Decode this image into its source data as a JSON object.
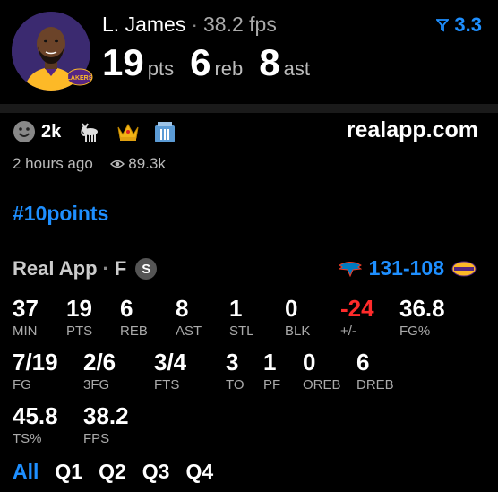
{
  "header": {
    "player_name": "L. James",
    "separator": "·",
    "fps_label": "38.2 fps",
    "rating": "3.3",
    "rating_icon": "filter-funnel-icon",
    "points": "19",
    "points_unit": "pts",
    "rebounds": "6",
    "rebounds_unit": "reb",
    "assists": "8",
    "assists_unit": "ast",
    "team_logo_text": "LAKERS"
  },
  "reactions": {
    "count": "2k",
    "icons": [
      "smiley-icon",
      "goat-icon",
      "crown-icon",
      "trash-icon"
    ]
  },
  "site": "realapp.com",
  "meta": {
    "time_ago": "2 hours ago",
    "views": "89.3k"
  },
  "hashtag": "#10points",
  "source": {
    "name": "Real App",
    "dot": "·",
    "position": "F",
    "badge": "S"
  },
  "score": {
    "home": "131",
    "dash": "-",
    "away": "108"
  },
  "stats_row1": [
    {
      "value": "37",
      "label": "MIN"
    },
    {
      "value": "19",
      "label": "PTS"
    },
    {
      "value": "6",
      "label": "REB"
    },
    {
      "value": "8",
      "label": "AST"
    },
    {
      "value": "1",
      "label": "STL"
    },
    {
      "value": "0",
      "label": "BLK"
    },
    {
      "value": "-24",
      "label": "+/-"
    },
    {
      "value": "36.8",
      "label": "FG%"
    }
  ],
  "stats_row2": [
    {
      "value": "7/19",
      "label": "FG"
    },
    {
      "value": "2/6",
      "label": "3FG"
    },
    {
      "value": "3/4",
      "label": "FTS"
    },
    {
      "value": "3",
      "label": "TO"
    },
    {
      "value": "1",
      "label": "PF"
    },
    {
      "value": "0",
      "label": "OREB"
    },
    {
      "value": "6",
      "label": "DREB"
    }
  ],
  "stats_row3": [
    {
      "value": "45.8",
      "label": "TS%"
    },
    {
      "value": "38.2",
      "label": "FPS"
    }
  ],
  "tabs": [
    "All",
    "Q1",
    "Q2",
    "Q3",
    "Q4"
  ],
  "colors": {
    "accent": "#1e8fff",
    "negative": "#ff2b2b",
    "lakers_gold": "#fdb927",
    "lakers_purple": "#552583"
  }
}
